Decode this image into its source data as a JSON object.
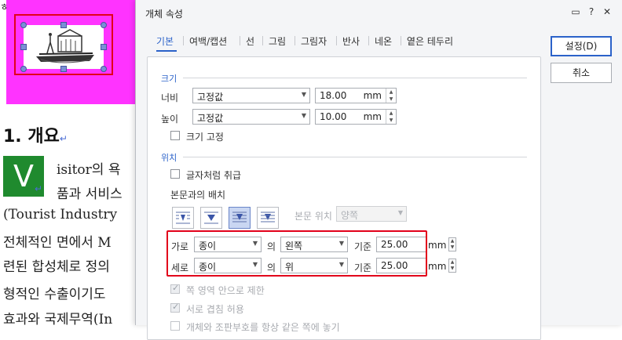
{
  "document": {
    "heading": "1. 개요",
    "return_mark": "↵",
    "dropcap": "V",
    "lines": [
      "isitor의 욕",
      "품과 서비스",
      "(Tourist Industry",
      "전체적인 면에서 M",
      "련된 합성체로 정의",
      "형적인 수출이기도",
      "효과와 국제무역(In"
    ],
    "corner_mark": "ㅎ"
  },
  "dialog": {
    "title": "개체 속성",
    "titlebar_icons": [
      "comment-icon",
      "help-icon",
      "close-icon"
    ],
    "titlebar_glyphs": {
      "comment": "▭",
      "help": "?",
      "close": "✕"
    },
    "tabs": [
      "기본",
      "여백/캡션",
      "선",
      "그림",
      "그림자",
      "반사",
      "네온",
      "옅은 테두리"
    ],
    "active_tab": 0,
    "size_section": {
      "title": "크기",
      "width_label": "너비",
      "width_mode": "고정값",
      "width_value": "18.00",
      "width_unit": "mm",
      "height_label": "높이",
      "height_mode": "고정값",
      "height_value": "10.00",
      "height_unit": "mm",
      "lock_size_label": "크기 고정",
      "lock_size_checked": false
    },
    "position_section": {
      "title": "위치",
      "treat_as_char_label": "글자처럼 취급",
      "treat_as_char_checked": false,
      "text_wrap_label": "본문과의 배치",
      "text_wrap_options": [
        "square-wrap-icon",
        "tight-wrap-icon",
        "behind-text-icon",
        "in-front-of-text-icon"
      ],
      "text_wrap_selected": 2,
      "body_pos_label": "본문 위치",
      "body_pos_value": "양쪽",
      "horizontal": {
        "label": "가로",
        "relative_to": "종이",
        "of_label": "의",
        "align": "왼쪽",
        "base_label": "기준",
        "value": "25.00",
        "unit": "mm"
      },
      "vertical": {
        "label": "세로",
        "relative_to": "종이",
        "of_label": "의",
        "align": "위",
        "base_label": "기준",
        "value": "25.00",
        "unit": "mm"
      },
      "limit_in_page_label": "쪽 영역 안으로 제한",
      "limit_in_page_checked": true,
      "allow_overlap_label": "서로 겹침 허용",
      "allow_overlap_checked": true,
      "partial_label": "개체와 조판부호를 항상 같은 쪽에 놓기"
    },
    "buttons": {
      "ok": "설정(D)",
      "cancel": "취소"
    }
  },
  "colors": {
    "accent": "#2b62c9",
    "highlight_outline": "#e2001a",
    "background_shape": "#ff33ff",
    "dropcap": "#1f8a2e"
  }
}
